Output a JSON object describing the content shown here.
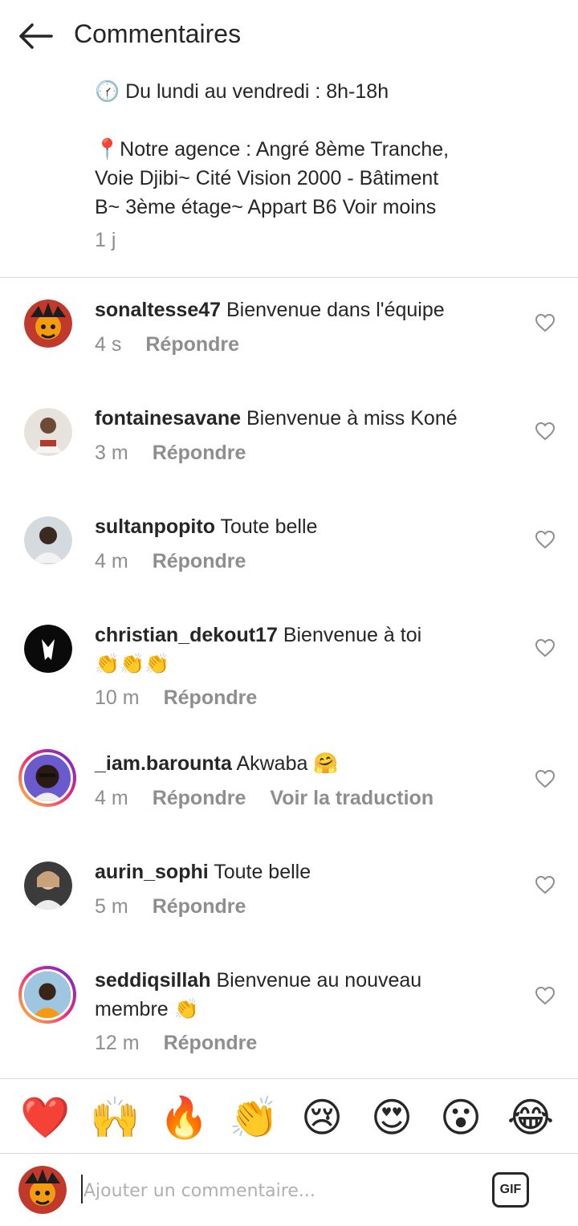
{
  "header": {
    "title": "Commentaires",
    "back_icon": "arrow-left-icon"
  },
  "caption": {
    "hours_icon": "🕜",
    "hours": "Du lundi au vendredi : 8h-18h",
    "address_icon": "📍",
    "address_line1": "Notre agence : Angré 8ème Tranche,",
    "address_line2": "Voie Djibi~ Cité Vision 2000 - Bâtiment",
    "address_line3": "B~ 3ème étage~ Appart B6",
    "see_less": "Voir moins",
    "time": "1 j"
  },
  "comments": [
    {
      "username": "sonaltesse47",
      "text": "Bienvenue dans l'équipe",
      "time": "4 s",
      "reply_label": "Répondre"
    },
    {
      "username": "fontainesavane",
      "text": "Bienvenue à miss Koné",
      "time": "3 m",
      "reply_label": "Répondre"
    },
    {
      "username": "sultanpopito",
      "text": "Toute belle",
      "time": "4 m",
      "reply_label": "Répondre"
    },
    {
      "username": "christian_dekout17",
      "text": "Bienvenue à toi",
      "text2": "👏👏👏",
      "time": "10 m",
      "reply_label": "Répondre"
    },
    {
      "username": "_iam.barounta",
      "text": "Akwaba 🤗",
      "time": "4 m",
      "reply_label": "Répondre",
      "translate_label": "Voir la traduction"
    },
    {
      "username": "aurin_sophi",
      "text": "Toute belle",
      "time": "5 m",
      "reply_label": "Répondre"
    },
    {
      "username": "seddiqsillah",
      "text": "Bienvenue au nouveau",
      "text2": "membre 👏",
      "time": "12 m",
      "reply_label": "Répondre"
    }
  ],
  "emoji_bar": [
    "❤️",
    "🙌",
    "🔥",
    "👏",
    "😢",
    "😍",
    "😮",
    "😂"
  ],
  "input": {
    "placeholder": "Ajouter un commentaire...",
    "gif_label": "GIF"
  },
  "colors": {
    "text": "#262626",
    "secondary": "#8e8e8e",
    "divider": "#dbdbdb",
    "story_ring_start": "#f9ce34",
    "story_ring_end": "#6228d7"
  }
}
